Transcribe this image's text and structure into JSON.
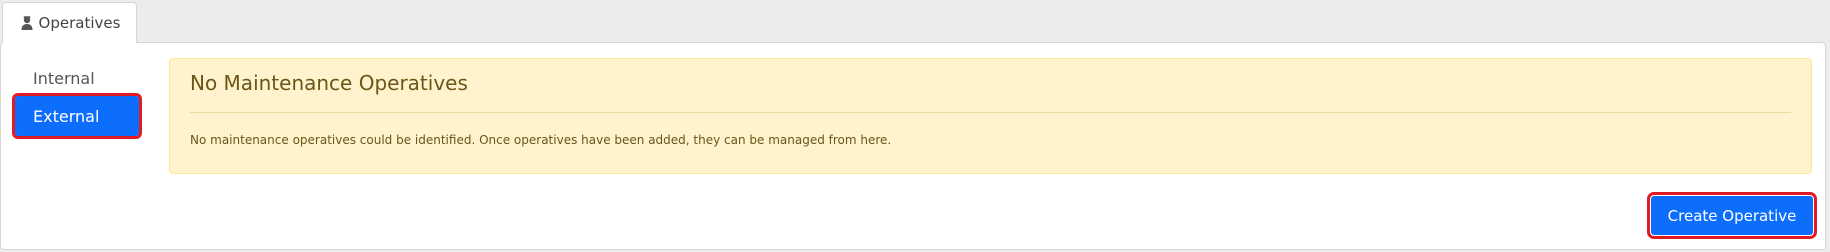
{
  "tab": {
    "label": "Operatives",
    "icon": "user-icon"
  },
  "nav": {
    "items": [
      {
        "label": "Internal",
        "active": false
      },
      {
        "label": "External",
        "active": true
      }
    ]
  },
  "alert": {
    "heading": "No Maintenance Operatives",
    "text": "No maintenance operatives could be identified. Once operatives have been added, they can be managed from here."
  },
  "actions": {
    "create_label": "Create Operative"
  },
  "colors": {
    "primary": "#0d6efd",
    "alert_bg": "#fff3cd",
    "alert_text": "#6b5617",
    "highlight": "#e01b24"
  }
}
